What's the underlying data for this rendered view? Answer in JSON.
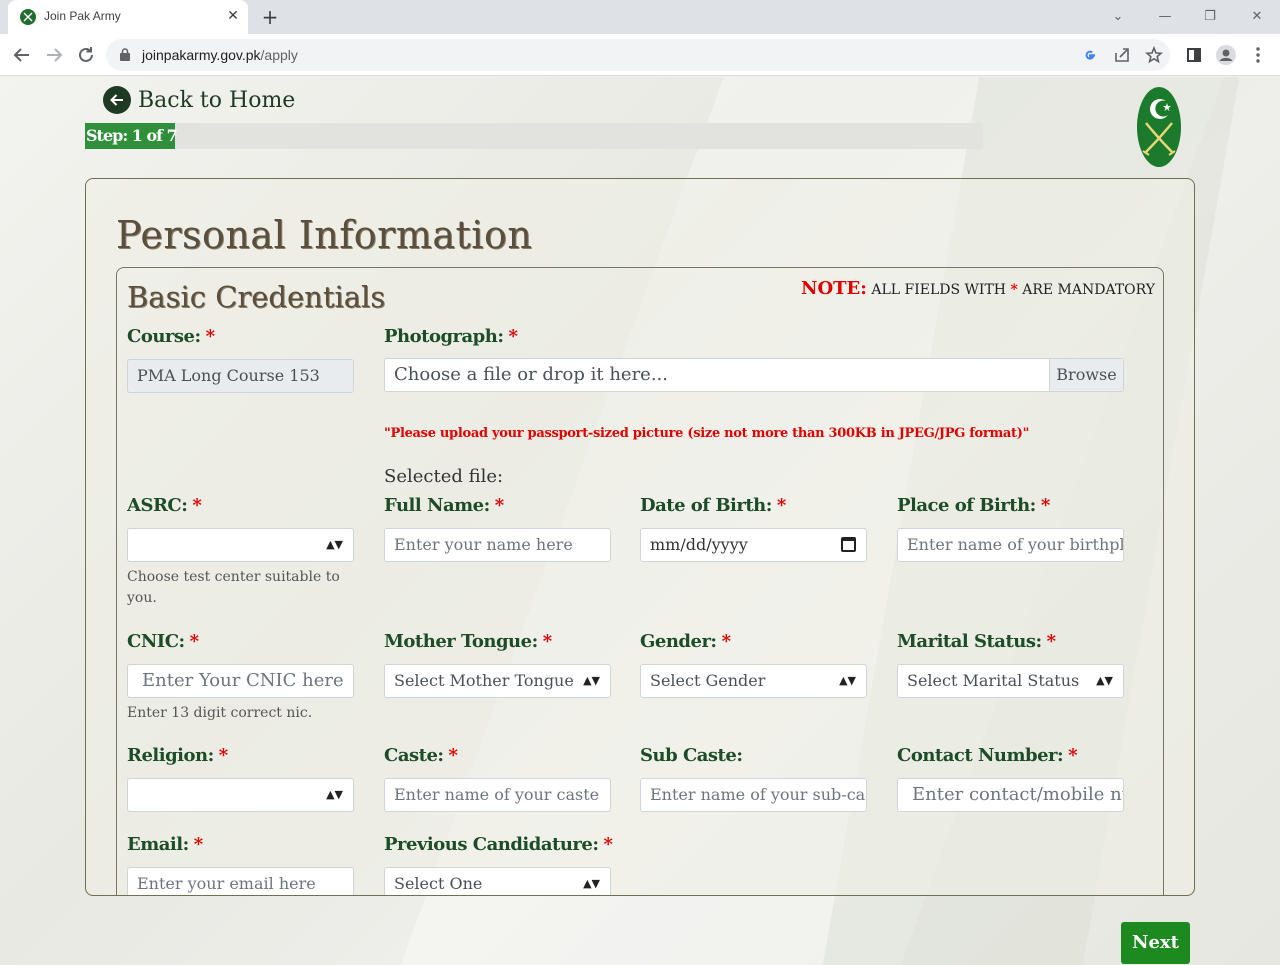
{
  "browser": {
    "tab_title": "Join Pak Army",
    "tab_close": "✕",
    "new_tab": "+",
    "url_host": "joinpakarmy.gov.pk",
    "url_path": "/apply",
    "win_min": "—",
    "win_restore": "❐",
    "win_close": "✕",
    "tab_search": "⌄"
  },
  "header": {
    "back_label": "Back to Home",
    "step_label": "Step: 1 of 7",
    "progress_fraction": 0.1
  },
  "form": {
    "title": "Personal Information",
    "section_title": "Basic Credentials",
    "note_prefix": "NOTE:",
    "note_text_before": "ALL FIELDS WITH",
    "note_star": "*",
    "note_text_after": "ARE MANDATORY",
    "required_mark": "*",
    "course": {
      "label": "Course:",
      "value": "PMA Long Course 153"
    },
    "photograph": {
      "label": "Photograph:",
      "placeholder": "Choose a file or drop it here...",
      "browse": "Browse",
      "warning": "\"Please upload your passport-sized picture (size not more than 300KB in JPEG/JPG format)\"",
      "selected_file": "Selected file:"
    },
    "asrc": {
      "label": "ASRC:",
      "value": "",
      "help": "Choose test center suitable to you."
    },
    "full_name": {
      "label": "Full Name:",
      "placeholder": "Enter your name here"
    },
    "dob": {
      "label": "Date of Birth:",
      "placeholder": "mm/dd/yyyy"
    },
    "place_of_birth": {
      "label": "Place of Birth:",
      "placeholder": "Enter name of your birthpla"
    },
    "cnic": {
      "label": "CNIC:",
      "placeholder": "Enter Your CNIC here",
      "help": "Enter 13 digit correct nic."
    },
    "mother_tongue": {
      "label": "Mother Tongue:",
      "value": "Select Mother Tongue"
    },
    "gender": {
      "label": "Gender:",
      "value": "Select Gender"
    },
    "marital_status": {
      "label": "Marital Status:",
      "value": "Select Marital Status"
    },
    "religion": {
      "label": "Religion:",
      "value": ""
    },
    "caste": {
      "label": "Caste:",
      "placeholder": "Enter name of your caste"
    },
    "sub_caste": {
      "label": "Sub Caste:",
      "placeholder": "Enter name of your sub-cast"
    },
    "contact": {
      "label": "Contact Number:",
      "placeholder": "Enter contact/mobile nu"
    },
    "email": {
      "label": "Email:",
      "placeholder": "Enter your email here"
    },
    "prev_candidature": {
      "label": "Previous Candidature:",
      "value": "Select One"
    },
    "select_arrow": "▲▼"
  },
  "footer": {
    "next_label": "Next"
  },
  "colors": {
    "brand_green": "#1c8a1f",
    "label_green": "#1d4d28",
    "required_red": "#e10000"
  }
}
